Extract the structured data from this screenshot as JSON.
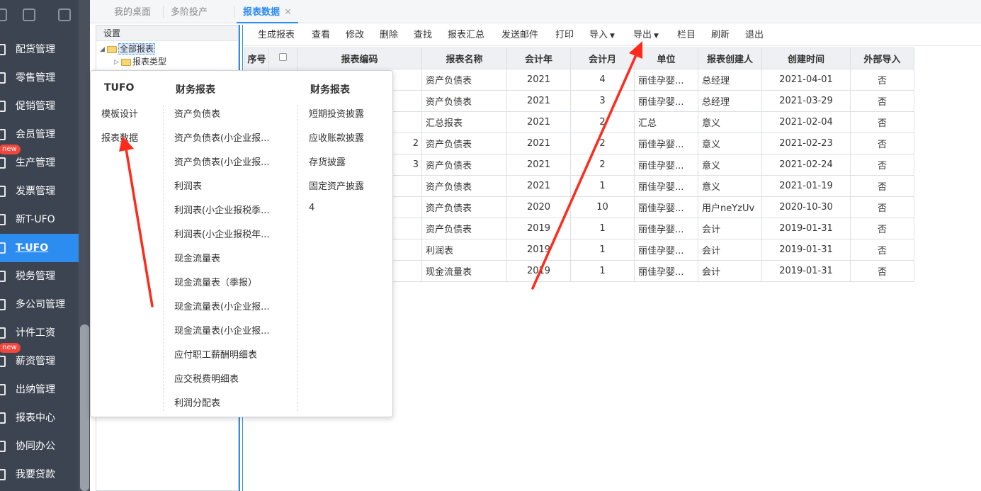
{
  "sidebar": {
    "items": [
      {
        "label": "配货管理",
        "badge": ""
      },
      {
        "label": "零售管理",
        "badge": ""
      },
      {
        "label": "促销管理",
        "badge": ""
      },
      {
        "label": "会员管理",
        "badge": ""
      },
      {
        "label": "生产管理",
        "badge": "new"
      },
      {
        "label": "发票管理",
        "badge": ""
      },
      {
        "label": "新T-UFO",
        "badge": ""
      },
      {
        "label": "T-UFO",
        "badge": "",
        "active": true
      },
      {
        "label": "税务管理",
        "badge": ""
      },
      {
        "label": "多公司管理",
        "badge": ""
      },
      {
        "label": "计件工资",
        "badge": ""
      },
      {
        "label": "薪资管理",
        "badge": "new"
      },
      {
        "label": "出纳管理",
        "badge": ""
      },
      {
        "label": "报表中心",
        "badge": ""
      },
      {
        "label": "协同办公",
        "badge": ""
      },
      {
        "label": "我要贷款",
        "badge": ""
      }
    ]
  },
  "tabs": [
    {
      "label": "我的桌面"
    },
    {
      "label": "多阶投产"
    },
    {
      "label": "报表数据",
      "active": true,
      "close": "✕"
    }
  ],
  "tree": {
    "header": "设置",
    "root": "全部报表",
    "child": "报表类型"
  },
  "toolbar": {
    "buttons": [
      "生成报表",
      "查看",
      "修改",
      "删除",
      "查找",
      "报表汇总",
      "发送邮件",
      "打印",
      "导入",
      "导出",
      "栏目",
      "刷新",
      "退出"
    ]
  },
  "grid": {
    "columns": [
      "序号",
      "",
      "报表编码",
      "报表名称",
      "会计年",
      "会计月",
      "单位",
      "报表创建人",
      "创建时间",
      "外部导入"
    ],
    "rows": [
      {
        "code": "",
        "name": "资产负债表",
        "year": "2021",
        "month": "4",
        "unit": "丽佳孕婴...",
        "creator": "总经理",
        "created": "2021-04-01",
        "ext": "否"
      },
      {
        "code": "",
        "name": "资产负债表",
        "year": "2021",
        "month": "3",
        "unit": "丽佳孕婴...",
        "creator": "总经理",
        "created": "2021-03-29",
        "ext": "否"
      },
      {
        "code": "",
        "name": "汇总报表",
        "year": "2021",
        "month": "2",
        "unit": "汇总",
        "creator": "意义",
        "created": "2021-02-04",
        "ext": "否"
      },
      {
        "code": "2",
        "name": "资产负债表",
        "year": "2021",
        "month": "2",
        "unit": "丽佳孕婴...",
        "creator": "意义",
        "created": "2021-02-23",
        "ext": "否"
      },
      {
        "code": "3",
        "name": "资产负债表",
        "year": "2021",
        "month": "2",
        "unit": "丽佳孕婴...",
        "creator": "意义",
        "created": "2021-02-24",
        "ext": "否"
      },
      {
        "code": "",
        "name": "资产负债表",
        "year": "2021",
        "month": "1",
        "unit": "丽佳孕婴...",
        "creator": "意义",
        "created": "2021-01-19",
        "ext": "否"
      },
      {
        "code": "",
        "name": "资产负债表",
        "year": "2020",
        "month": "10",
        "unit": "丽佳孕婴...",
        "creator": "用户neYzUv",
        "created": "2020-10-30",
        "ext": "否"
      },
      {
        "code": "",
        "name": "资产负债表",
        "year": "2019",
        "month": "1",
        "unit": "丽佳孕婴...",
        "creator": "会计",
        "created": "2019-01-31",
        "ext": "否"
      },
      {
        "code": "",
        "name": "利润表",
        "year": "2019",
        "month": "1",
        "unit": "丽佳孕婴...",
        "creator": "会计",
        "created": "2019-01-31",
        "ext": "否"
      },
      {
        "code": "",
        "name": "现金流量表",
        "year": "2019",
        "month": "1",
        "unit": "丽佳孕婴...",
        "creator": "会计",
        "created": "2019-01-31",
        "ext": "否"
      }
    ]
  },
  "popup": {
    "col1": {
      "title": "TUFO",
      "items": [
        "模板设计",
        "报表数据"
      ]
    },
    "col2": {
      "title": "财务报表",
      "items": [
        "资产负债表",
        "资产负债表(小企业报...",
        "资产负债表(小企业报...",
        "利润表",
        "利润表(小企业报税季...",
        "利润表(小企业报税年...",
        "现金流量表",
        "现金流量表（季报）",
        "现金流量表(小企业报...",
        "现金流量表(小企业报...",
        "应付职工薪酬明细表",
        "应交税费明细表",
        "利润分配表"
      ]
    },
    "col3": {
      "title": "财务报表",
      "items": [
        "短期投资披露",
        "应收账款披露",
        "存货披露",
        "固定资产披露",
        "4"
      ]
    }
  },
  "colors": {
    "accent": "#2d8cf0",
    "sidebar": "#3d4451",
    "badge": "#f0463c",
    "arrow": "#ff2a1a"
  }
}
